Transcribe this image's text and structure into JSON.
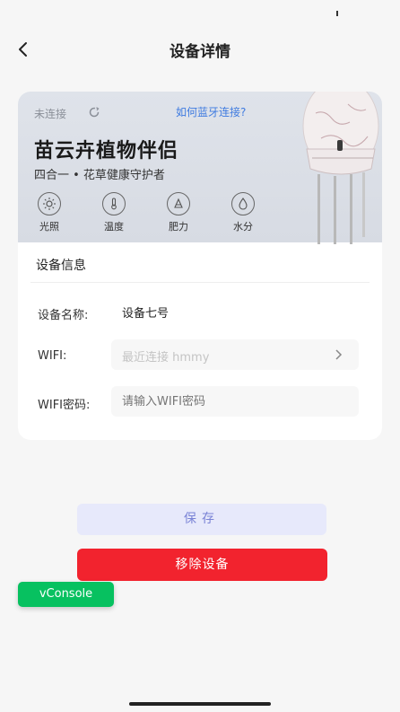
{
  "nav": {
    "title": "设备详情"
  },
  "banner": {
    "connection_status": "未连接",
    "bluetooth_help_link": "如何蓝牙连接?",
    "product_title": "苗云卉植物伴侣",
    "product_subtitle": "四合一 • 花草健康守护者",
    "features": [
      {
        "label": "光照",
        "icon": "sun-icon"
      },
      {
        "label": "温度",
        "icon": "thermometer-icon"
      },
      {
        "label": "肥力",
        "icon": "fertility-icon"
      },
      {
        "label": "水分",
        "icon": "water-drop-icon"
      }
    ]
  },
  "device_info": {
    "section_title": "设备信息",
    "name_label": "设备名称:",
    "name_value": "设备七号",
    "wifi_label": "WIFI:",
    "wifi_placeholder": "最近连接 hmmy",
    "password_label": "WIFI密码:",
    "password_placeholder": "请输入WIFI密码"
  },
  "actions": {
    "save_label": "保存",
    "remove_label": "移除设备"
  },
  "debug": {
    "vconsole_label": "vConsole"
  },
  "colors": {
    "link": "#3f7be0",
    "save_bg": "#e7e9fb",
    "save_text": "#7a83d6",
    "remove_bg": "#f2232e",
    "vconsole_bg": "#07c160"
  }
}
